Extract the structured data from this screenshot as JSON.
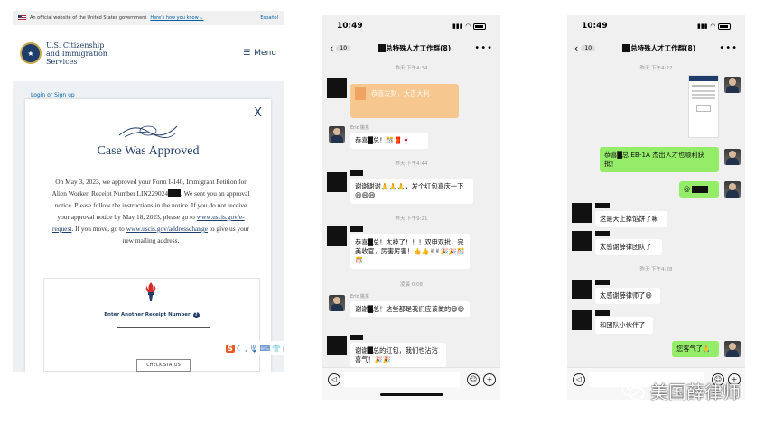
{
  "uscis": {
    "gov_banner": "An official website of the United States government",
    "gov_banner_link": "Here's how you know ⌄",
    "espanol": "Español",
    "logo_line1": "U.S. Citizenship",
    "logo_line2": "and Immigration",
    "logo_line3": "Services",
    "menu_label": "Menu",
    "login_link": "Login or Sign up",
    "close_label": "X",
    "card_title": "Case Was Approved",
    "body_p1": "On May 3, 2023, we approved your Form I-140, Immigrant Petition for Alien Worker, Receipt Number LIN229024",
    "body_p2": ". We sent you an approval notice. Please follow the instructions in the notice. If you do not receive your approval notice by May 18, 2023, please go to ",
    "link_erequest": "www.uscis.gov/e-request",
    "body_p3": ". If you move, go to ",
    "link_address": "www.uscis.gov/addresschange",
    "body_p4": " to give us your new mailing address.",
    "receipt_label": "Enter Another Receipt Number",
    "receipt_value": "",
    "check_status": "CHECK STATUS",
    "ime_letter": "S"
  },
  "phone1": {
    "time": "10:49",
    "back_count": "10",
    "title": "总特殊人才工作群(8)",
    "ts1": "昨天 下午4:34",
    "orange_bubble": "恭喜发财，大吉大利",
    "name1": "Eric 姚东",
    "msg1": "恭喜█总！🎊🧧🍷",
    "ts2": "昨天 下午4:44",
    "msg2": "谢谢谢谢🙏🙏🙏，发个红包喜庆一下😄😄😄",
    "ts3": "昨天 下午9:21",
    "msg3": "恭喜█总！太棒了！！！双申双批，完美收官，厉害厉害！👍👍✌✌🎉🎉🎊🎊",
    "ts4": "凌晨 0:08",
    "name2": "Eric 姚东",
    "msg4": "谢谢█总！这些都是我们应该做的😄😄",
    "msg5": "谢谢█总的红包，我们也沾沾喜气！🎉🎉"
  },
  "phone2": {
    "time": "10:49",
    "back_count": "10",
    "title": "总特殊人才工作群(8)",
    "ts1": "昨天 下午4:22",
    "msg1": "恭喜█总 EB-1A 杰出人才也顺利获批！",
    "msg2": "@",
    "msg3": "这是天上掉馅饼了嘛",
    "msg4": "太感谢薛律团队了",
    "ts2": "昨天 下午4:28",
    "msg5": "太感谢薛律师了😄",
    "msg6": "和团队小伙伴了",
    "msg7": "您客气了🙏"
  },
  "watermark": "美国薛律师",
  "colors": {
    "uscis_navy": "#1f3d6b",
    "wechat_green": "#95ec69",
    "chat_bg": "#f0f0f0"
  }
}
